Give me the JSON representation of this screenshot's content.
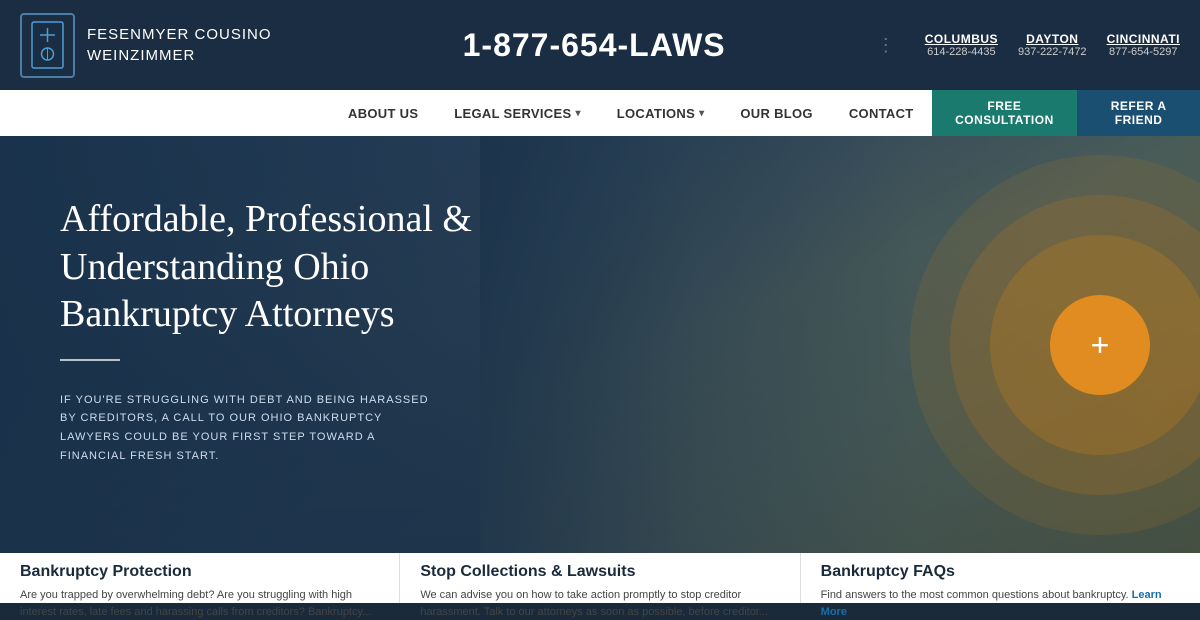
{
  "logo": {
    "firm_name_line1": "Fesenmyer Cousino",
    "firm_name_line2": "Weinzimmer",
    "icon_symbol": "⚖"
  },
  "phone": {
    "number": "1-877-654-LAWS"
  },
  "offices": [
    {
      "city": "COLUMBUS",
      "phone": "614-228-4435"
    },
    {
      "city": "DAYTON",
      "phone": "937-222-7472"
    },
    {
      "city": "CINCINNATI",
      "phone": "877-654-5297"
    }
  ],
  "nav": {
    "items": [
      {
        "label": "ABOUT US",
        "has_dropdown": false
      },
      {
        "label": "LEGAL SERVICES",
        "has_dropdown": true
      },
      {
        "label": "LOCATIONS",
        "has_dropdown": true
      },
      {
        "label": "OUR BLOG",
        "has_dropdown": false
      },
      {
        "label": "CONTACT",
        "has_dropdown": false
      }
    ],
    "btn_consultation": "FREE CONSULTATION",
    "btn_refer": "REFER A FRIEND"
  },
  "hero": {
    "title": "Affordable, Professional & Understanding Ohio Bankruptcy Attorneys",
    "subtitle": "IF YOU'RE STRUGGLING WITH DEBT AND BEING HARASSED BY CREDITORS, A CALL TO OUR OHIO BANKRUPTCY LAWYERS COULD BE YOUR FIRST STEP TOWARD A FINANCIAL FRESH START.",
    "circle_icon": "+"
  },
  "cards": [
    {
      "title": "Bankruptcy Protection",
      "text": "Are you trapped by overwhelming debt? Are you struggling with high interest rates, late fees and harassing calls from creditors? Bankruptcy..."
    },
    {
      "title": "Stop Collections & Lawsuits",
      "text": "We can advise you on how to take action promptly to stop creditor harassment. Talk to our attorneys as soon as possible, before creditor..."
    },
    {
      "title": "Bankruptcy FAQs",
      "text": "Find answers to the most common questions about bankruptcy.",
      "link_text": "Learn More"
    }
  ]
}
